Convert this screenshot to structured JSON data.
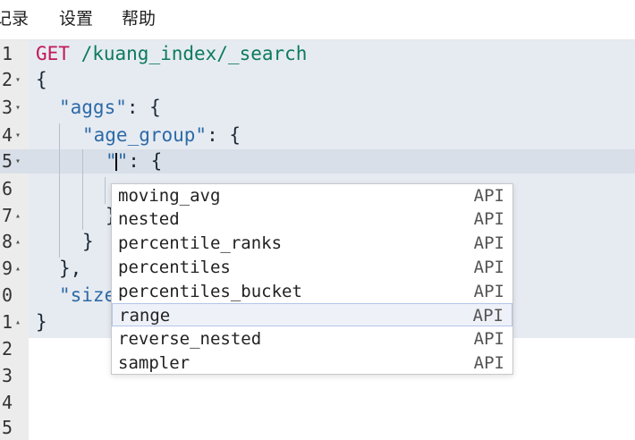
{
  "menu": {
    "items": [
      "记录",
      "设置",
      "帮助"
    ]
  },
  "editor": {
    "gutter": [
      {
        "num": "1",
        "fold": ""
      },
      {
        "num": "2",
        "fold": "▾"
      },
      {
        "num": "3",
        "fold": "▾"
      },
      {
        "num": "4",
        "fold": "▾"
      },
      {
        "num": "5",
        "fold": "▾"
      },
      {
        "num": "6",
        "fold": ""
      },
      {
        "num": "7",
        "fold": "▴"
      },
      {
        "num": "8",
        "fold": "▴"
      },
      {
        "num": "9",
        "fold": "▴"
      },
      {
        "num": "0",
        "fold": ""
      },
      {
        "num": "1",
        "fold": "▴"
      },
      {
        "num": "2",
        "fold": ""
      },
      {
        "num": "3",
        "fold": ""
      },
      {
        "num": "4",
        "fold": ""
      },
      {
        "num": "5",
        "fold": ""
      }
    ],
    "lines": {
      "l1_method": "GET",
      "l1_path": " /kuang_index/_search",
      "l2": "{",
      "l3_key": "\"aggs\"",
      "l3_rest": ": {",
      "l4_key": "\"age_group\"",
      "l4_rest": ": {",
      "l5_key": "\"\"",
      "l5_rest": ": {",
      "l7": "}",
      "l8": "}",
      "l9": "},",
      "l10_key": "\"size",
      "l11": "}"
    }
  },
  "autocomplete": {
    "selected_index": 5,
    "items": [
      {
        "label": "moving_avg",
        "meta": "API"
      },
      {
        "label": "nested",
        "meta": "API"
      },
      {
        "label": "percentile_ranks",
        "meta": "API"
      },
      {
        "label": "percentiles",
        "meta": "API"
      },
      {
        "label": "percentiles_bucket",
        "meta": "API"
      },
      {
        "label": "range",
        "meta": "API"
      },
      {
        "label": "reverse_nested",
        "meta": "API"
      },
      {
        "label": "sampler",
        "meta": "API"
      }
    ]
  }
}
